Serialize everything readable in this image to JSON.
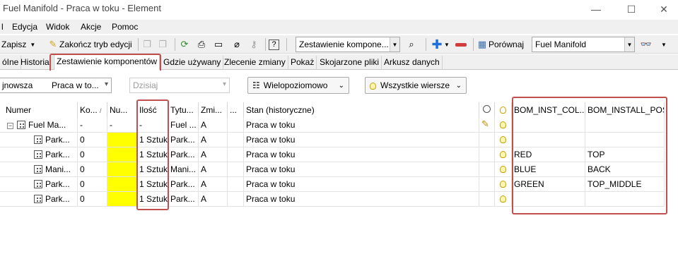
{
  "window": {
    "title": "Fuel Manifold - Praca w toku - Element"
  },
  "menubar": {
    "items": [
      "l",
      "Edycja",
      "Widok",
      "Akcje",
      "Pomoc"
    ]
  },
  "toolbar": {
    "save": "Zapisz",
    "finish_edit": "Zakończ tryb edycji",
    "view_select": "Zestawienie kompone...",
    "compare": "Porównaj",
    "compare_target": "Fuel Manifold"
  },
  "tabs": [
    "óIne",
    "Historia",
    "Zestawienie komponentów",
    "Gdzie używany",
    "Zlecenie zmiany",
    "Pokaż",
    "Skojarzone pliki",
    "Arkusz danych"
  ],
  "filters": {
    "revision_label": "jnowsza",
    "status_value": "Praca w to...",
    "date_placeholder": "Dzisiaj",
    "level_button": "Wielopoziomowo",
    "rows_button": "Wszystkie wiersze"
  },
  "table": {
    "columns": [
      "Numer",
      "Ko...",
      "Nu...",
      "Ilość",
      "Tytu...",
      "Zmi...",
      "...",
      "Stan (historyczne)",
      "",
      "",
      "BOM_INST_COL...",
      "BOM_INSTALL_POS"
    ],
    "rows": [
      {
        "numer": "Fuel Ma...",
        "ko": "-",
        "nu": "-",
        "ilosc": "-",
        "tytul": "Fuel ...",
        "zmi": "A",
        "stan": "Praca w toku",
        "color": "",
        "pos": "",
        "root": true
      },
      {
        "numer": "Park...",
        "ko": "0",
        "nu": "",
        "ilosc": "1 Sztuk",
        "tytul": "Park...",
        "zmi": "A",
        "stan": "Praca w toku",
        "color": "",
        "pos": ""
      },
      {
        "numer": "Park...",
        "ko": "0",
        "nu": "",
        "ilosc": "1 Sztuk",
        "tytul": "Park...",
        "zmi": "A",
        "stan": "Praca w toku",
        "color": "RED",
        "pos": "TOP"
      },
      {
        "numer": "Mani...",
        "ko": "0",
        "nu": "",
        "ilosc": "1 Sztuk",
        "tytul": "Mani...",
        "zmi": "A",
        "stan": "Praca w toku",
        "color": "BLUE",
        "pos": "BACK"
      },
      {
        "numer": "Park...",
        "ko": "0",
        "nu": "",
        "ilosc": "1 Sztuk",
        "tytul": "Park...",
        "zmi": "A",
        "stan": "Praca w toku",
        "color": "GREEN",
        "pos": "TOP_MIDDLE"
      },
      {
        "numer": "Park...",
        "ko": "0",
        "nu": "",
        "ilosc": "1 Sztuk",
        "tytul": "Park...",
        "zmi": "A",
        "stan": "Praca w toku",
        "color": "",
        "pos": ""
      }
    ]
  },
  "colors": {
    "highlight_box": "#c0504d",
    "yellow_cell": "#ffff00",
    "toolbar_bg": "#f0f0f0"
  },
  "icons": [
    "save-icon",
    "pencil-icon",
    "refresh-icon",
    "print-icon",
    "attach-icon",
    "help-icon",
    "plus-icon",
    "minus-icon",
    "compare-icon",
    "binoculars-icon",
    "bulb-icon"
  ]
}
